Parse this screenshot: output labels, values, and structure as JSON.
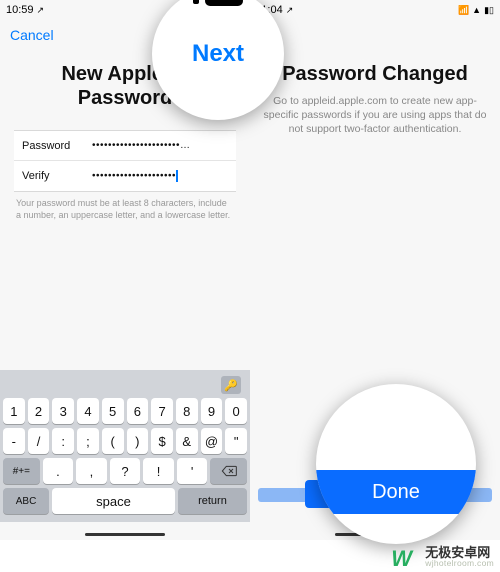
{
  "left": {
    "status": {
      "time": "10:59",
      "arrow": "↗"
    },
    "nav": {
      "cancel": "Cancel"
    },
    "heading_1": "New Apple ID",
    "heading_2": "Password",
    "form": {
      "password_label": "Password",
      "password_value": "••••••••••••••••••••••…",
      "verify_label": "Verify",
      "verify_value": "•••••••••••••••••••••"
    },
    "hint": "Your password must be at least 8 characters, include a number, an uppercase letter, and a lowercase letter."
  },
  "right": {
    "status": {
      "time": "11:04",
      "arrow": "↗"
    },
    "heading": "Password Changed",
    "subtext": "Go to appleid.apple.com to create new app-specific passwords if you are using apps that do not support two-factor authentication.",
    "done": "Done"
  },
  "keyboard": {
    "row1": [
      "1",
      "2",
      "3",
      "4",
      "5",
      "6",
      "7",
      "8",
      "9",
      "0"
    ],
    "row2": [
      "-",
      "/",
      ":",
      ";",
      "(",
      ")",
      "$",
      "&",
      "@",
      "\""
    ],
    "row3_alt": "#+=",
    "row3": [
      ".",
      ",",
      "?",
      "!",
      "'"
    ],
    "abc": "ABC",
    "space": "space",
    "return": "return"
  },
  "magnifier": {
    "next": "Next",
    "done": "Done"
  },
  "watermark": {
    "name": "无极安卓网",
    "url": "wjhotelroom.com"
  }
}
